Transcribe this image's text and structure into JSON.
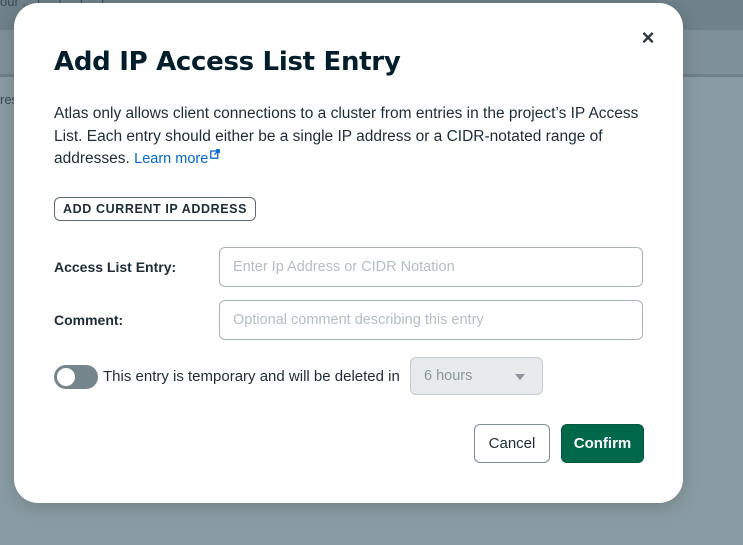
{
  "background": {
    "top_bar_text": "our ... f ... i ... f ... t",
    "side_text": "res"
  },
  "modal": {
    "title": "Add IP Access List Entry",
    "description": "Atlas only allows client connections to a cluster from entries in the project’s IP Access List. Each entry should either be a single IP address or a CIDR-notated range of addresses.",
    "learn_more_label": "Learn more",
    "add_current_ip_label": "ADD CURRENT IP ADDRESS",
    "access_list_entry": {
      "label": "Access List Entry:",
      "value": "",
      "placeholder": "Enter Ip Address or CIDR Notation"
    },
    "comment": {
      "label": "Comment:",
      "value": "",
      "placeholder": "Optional comment describing this entry"
    },
    "temporary": {
      "enabled": false,
      "label": "This entry is temporary and will be deleted in",
      "duration_selected": "6 hours"
    },
    "cancel_label": "Cancel",
    "confirm_label": "Confirm",
    "close_icon": "close-icon",
    "close_glyph": "×"
  },
  "colors": {
    "brand_green": "#00684a",
    "link_blue": "#0068d6",
    "text_dark": "#001e2b",
    "overlay": "#7a8d95"
  }
}
